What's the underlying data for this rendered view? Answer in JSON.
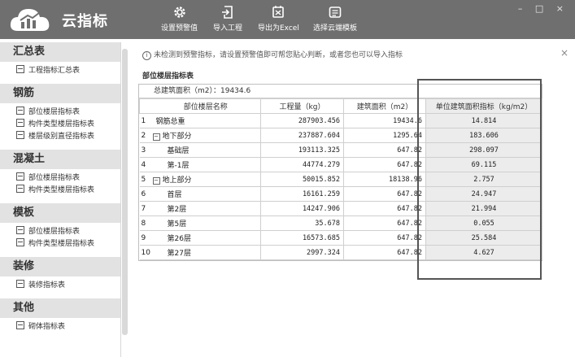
{
  "app": {
    "title": "云指标"
  },
  "toolbar": [
    {
      "label": "设置预警值",
      "icon": "gear-icon"
    },
    {
      "label": "导入工程",
      "icon": "import-icon"
    },
    {
      "label": "导出为Excel",
      "icon": "excel-export-icon"
    },
    {
      "label": "选择云端模板",
      "icon": "template-icon"
    }
  ],
  "window_controls": {
    "minimize": "–",
    "restore": "□",
    "close": "×"
  },
  "sidebar": [
    {
      "title": "汇总表",
      "items": [
        "工程指标汇总表"
      ]
    },
    {
      "title": "钢筋",
      "items": [
        "部位楼层指标表",
        "构件类型楼层指标表",
        "楼层级别直径指标表"
      ]
    },
    {
      "title": "混凝土",
      "items": [
        "部位楼层指标表",
        "构件类型楼层指标表"
      ]
    },
    {
      "title": "模板",
      "items": [
        "部位楼层指标表",
        "构件类型楼层指标表"
      ]
    },
    {
      "title": "装修",
      "items": [
        "装修指标表"
      ]
    },
    {
      "title": "其他",
      "items": [
        "砌体指标表"
      ]
    }
  ],
  "notice": {
    "icon": "info-icon",
    "text": "未检测到预警指标，请设置预警值即可帮您贴心判断，或者您也可以导入指标",
    "close": "×"
  },
  "table_title": "部位楼层指标表",
  "total_area": "总建筑面积（m2）：19434.6",
  "columns": [
    "部位楼层名称",
    "工程量（kg）",
    "建筑面积（m2）",
    "单位建筑面积指标（kg/m2）"
  ],
  "rows": [
    {
      "idx": "1",
      "name": "钢筋总重",
      "level": 0,
      "toggle": "",
      "qty": "287903.456",
      "area": "19434.6",
      "index": "14.814"
    },
    {
      "idx": "2",
      "name": "地下部分",
      "level": 0,
      "toggle": "−",
      "qty": "237887.604",
      "area": "1295.64",
      "index": "183.606"
    },
    {
      "idx": "3",
      "name": "基础层",
      "level": 1,
      "toggle": "",
      "qty": "193113.325",
      "area": "647.82",
      "index": "298.097"
    },
    {
      "idx": "4",
      "name": "第-1层",
      "level": 1,
      "toggle": "",
      "qty": "44774.279",
      "area": "647.82",
      "index": "69.115"
    },
    {
      "idx": "5",
      "name": "地上部分",
      "level": 0,
      "toggle": "−",
      "qty": "50015.852",
      "area": "18138.96",
      "index": "2.757"
    },
    {
      "idx": "6",
      "name": "首层",
      "level": 1,
      "toggle": "",
      "qty": "16161.259",
      "area": "647.82",
      "index": "24.947"
    },
    {
      "idx": "7",
      "name": "第2层",
      "level": 1,
      "toggle": "",
      "qty": "14247.906",
      "area": "647.82",
      "index": "21.994"
    },
    {
      "idx": "8",
      "name": "第5层",
      "level": 1,
      "toggle": "",
      "qty": "35.678",
      "area": "647.82",
      "index": "0.055"
    },
    {
      "idx": "9",
      "name": "第26层",
      "level": 1,
      "toggle": "",
      "qty": "16573.685",
      "area": "647.82",
      "index": "25.584"
    },
    {
      "idx": "10",
      "name": "第27层",
      "level": 1,
      "toggle": "",
      "qty": "2997.324",
      "area": "647.82",
      "index": "4.627"
    }
  ]
}
